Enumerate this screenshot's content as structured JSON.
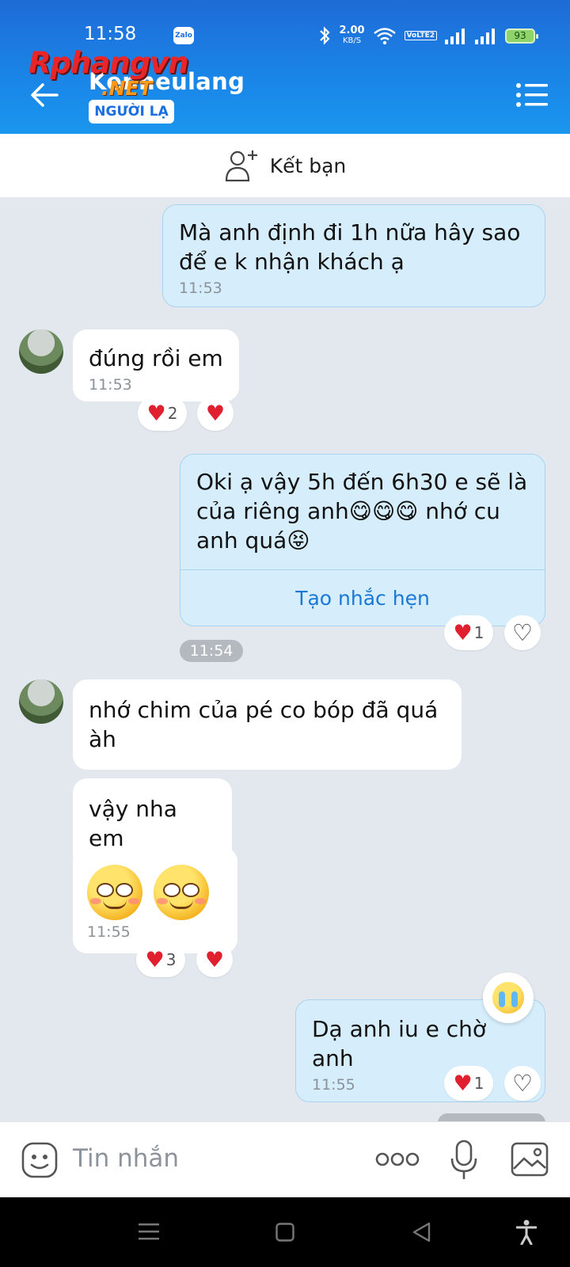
{
  "status_bar": {
    "time": "11:58",
    "app_badge": "Zalo",
    "net_speed_value": "2.00",
    "net_speed_unit": "KB/S",
    "volte": "VoLTE2",
    "battery": "93"
  },
  "header": {
    "contact_name": "Kenheulang",
    "stranger_badge": "NGƯỜI LẠ",
    "watermark": "Rphangvn",
    "watermark_suffix": ".NET"
  },
  "add_friend": {
    "label": "Kết bạn"
  },
  "messages": [
    {
      "side": "me",
      "text": "Mà anh định đi 1h nữa hây sao để e k nhận khách ạ",
      "time": "11:53"
    },
    {
      "side": "other",
      "text": "đúng rồi em",
      "time": "11:53",
      "reactions": {
        "count": "2"
      }
    },
    {
      "side": "me",
      "text": "Oki ạ vậy 5h đến 6h30 e sẽ là của riêng anh😋😋😋 nhớ cu anh quá😝",
      "action": "Tạo nhắc hẹn",
      "reactions": {
        "count": "1"
      }
    },
    {
      "side": "other",
      "text": "nhớ chim của pé co bóp đã quá àh"
    },
    {
      "side": "other",
      "text": "vậy nha em"
    },
    {
      "side": "other",
      "time": "11:55",
      "reactions": {
        "count": "3"
      }
    },
    {
      "side": "me",
      "text": "Dạ anh iu e chờ anh",
      "time": "11:55",
      "reactions": {
        "count": "1"
      }
    }
  ],
  "time_divider": "11:54",
  "input": {
    "placeholder": "Tin nhắn"
  }
}
